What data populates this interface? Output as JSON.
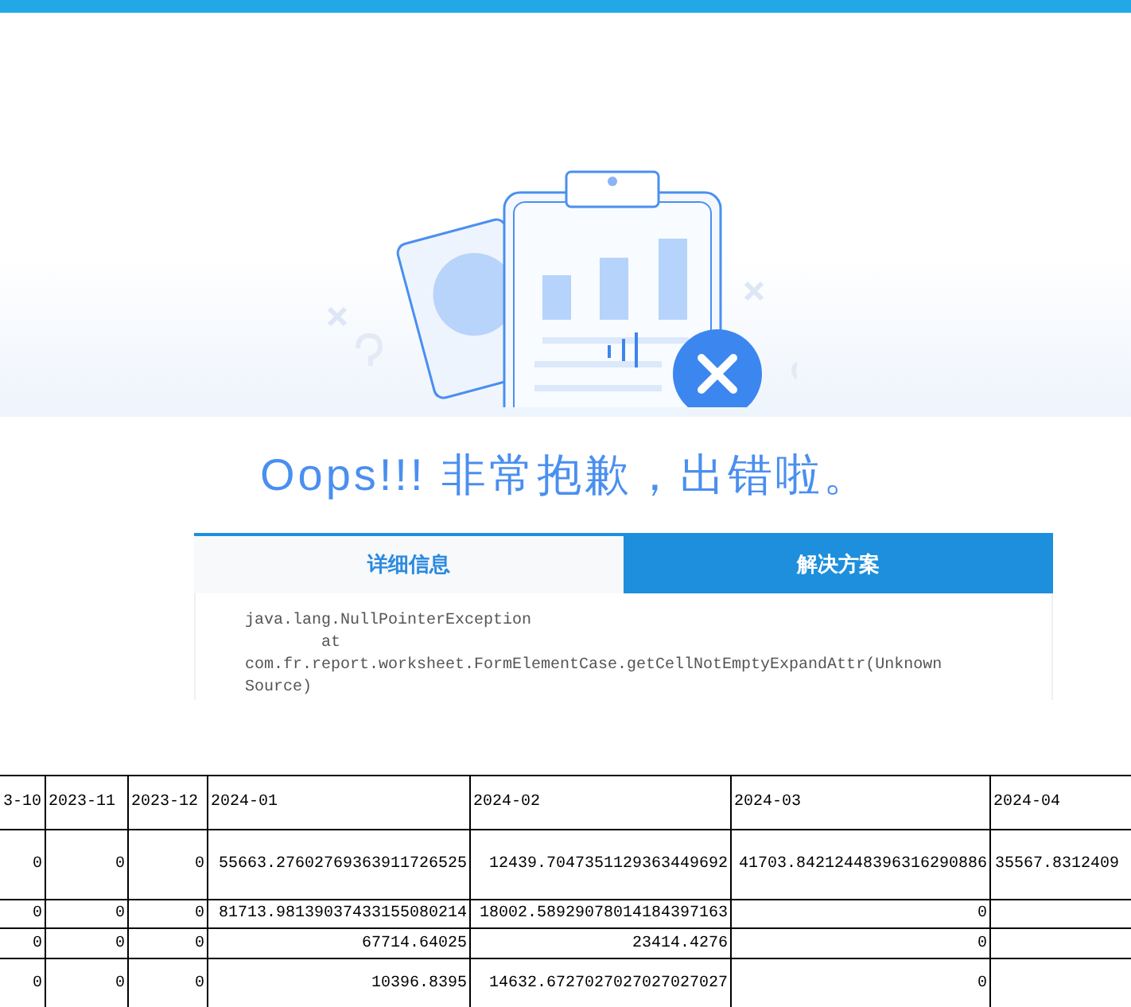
{
  "error": {
    "title": "Oops!!! 非常抱歉，出错啦。",
    "tabs": [
      {
        "label": "详细信息",
        "selected": false
      },
      {
        "label": "解决方案",
        "selected": true
      }
    ],
    "detail_lines": [
      "java.lang.NullPointerException",
      "        at",
      "com.fr.report.worksheet.FormElementCase.getCellNotEmptyExpandAttr(Unknown",
      "Source)"
    ]
  },
  "table": {
    "columns": [
      "3-10",
      "2023-11",
      "2023-12",
      "2024-01",
      "2024-02",
      "2024-03",
      "2024-04"
    ],
    "rows": [
      [
        "0",
        "0",
        "0",
        "55663.27602769363911726525",
        "12439.7047351129363449692",
        "41703.84212448396316290886",
        "35567.8312409"
      ],
      [
        "0",
        "0",
        "0",
        "81713.98139037433155080214",
        "18002.58929078014184397163",
        "0",
        ""
      ],
      [
        "0",
        "0",
        "0",
        "67714.64025",
        "23414.4276",
        "0",
        ""
      ],
      [
        "0",
        "0",
        "0",
        "10396.8395",
        "14632.6727027027027027027",
        "0",
        ""
      ]
    ]
  }
}
